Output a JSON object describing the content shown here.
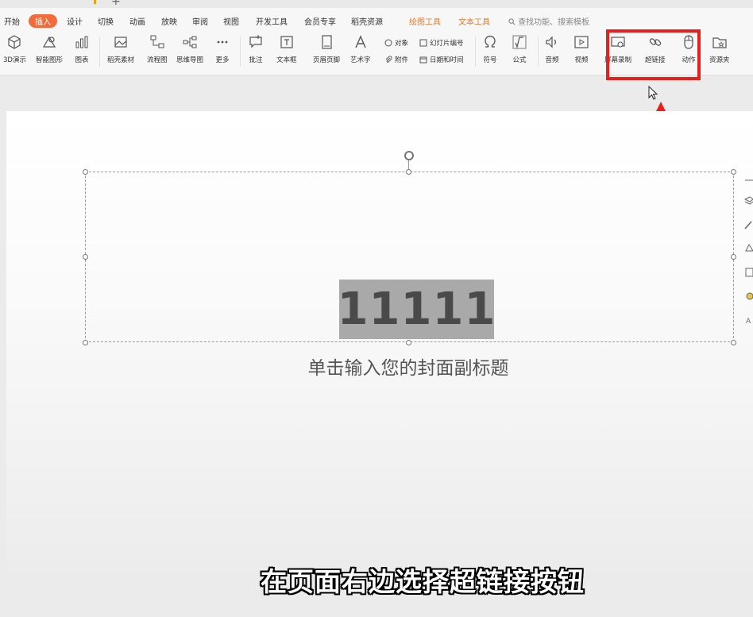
{
  "menubar": {
    "items": [
      "开始",
      "插入",
      "设计",
      "切换",
      "动画",
      "放映",
      "审阅",
      "视图",
      "开发工具",
      "会员专享",
      "稻壳资源"
    ],
    "active": "插入",
    "context_tabs": [
      "绘图工具",
      "文本工具"
    ],
    "search_placeholder": "查找功能、搜索模板"
  },
  "ribbon": {
    "buttons": {
      "d3": "3D演示",
      "smart": "智能图形",
      "chart": "图表",
      "stock": "稻壳素材",
      "flow": "流程图",
      "mind": "思维导图",
      "more": "更多",
      "comment": "批注",
      "textbox": "文本框",
      "header": "页眉页脚",
      "art": "艺术字",
      "object": "对象",
      "attach": "附件",
      "slide_num": "幻灯片编号",
      "datetime": "日期和时间",
      "symbol": "符号",
      "formula": "公式",
      "audio": "音频",
      "video": "视频",
      "screen_rec": "屏幕录制",
      "hyperlink": "超链接",
      "action": "动作",
      "resources": "资源夹"
    }
  },
  "slide": {
    "title": "11111",
    "subtitle": "单击输入您的封面副标题"
  },
  "caption": "在页面右边选择超链接按钮",
  "colors": {
    "accent": "#f26b3a",
    "highlight": "#e8201c",
    "context_tab": "#e07b2a"
  }
}
